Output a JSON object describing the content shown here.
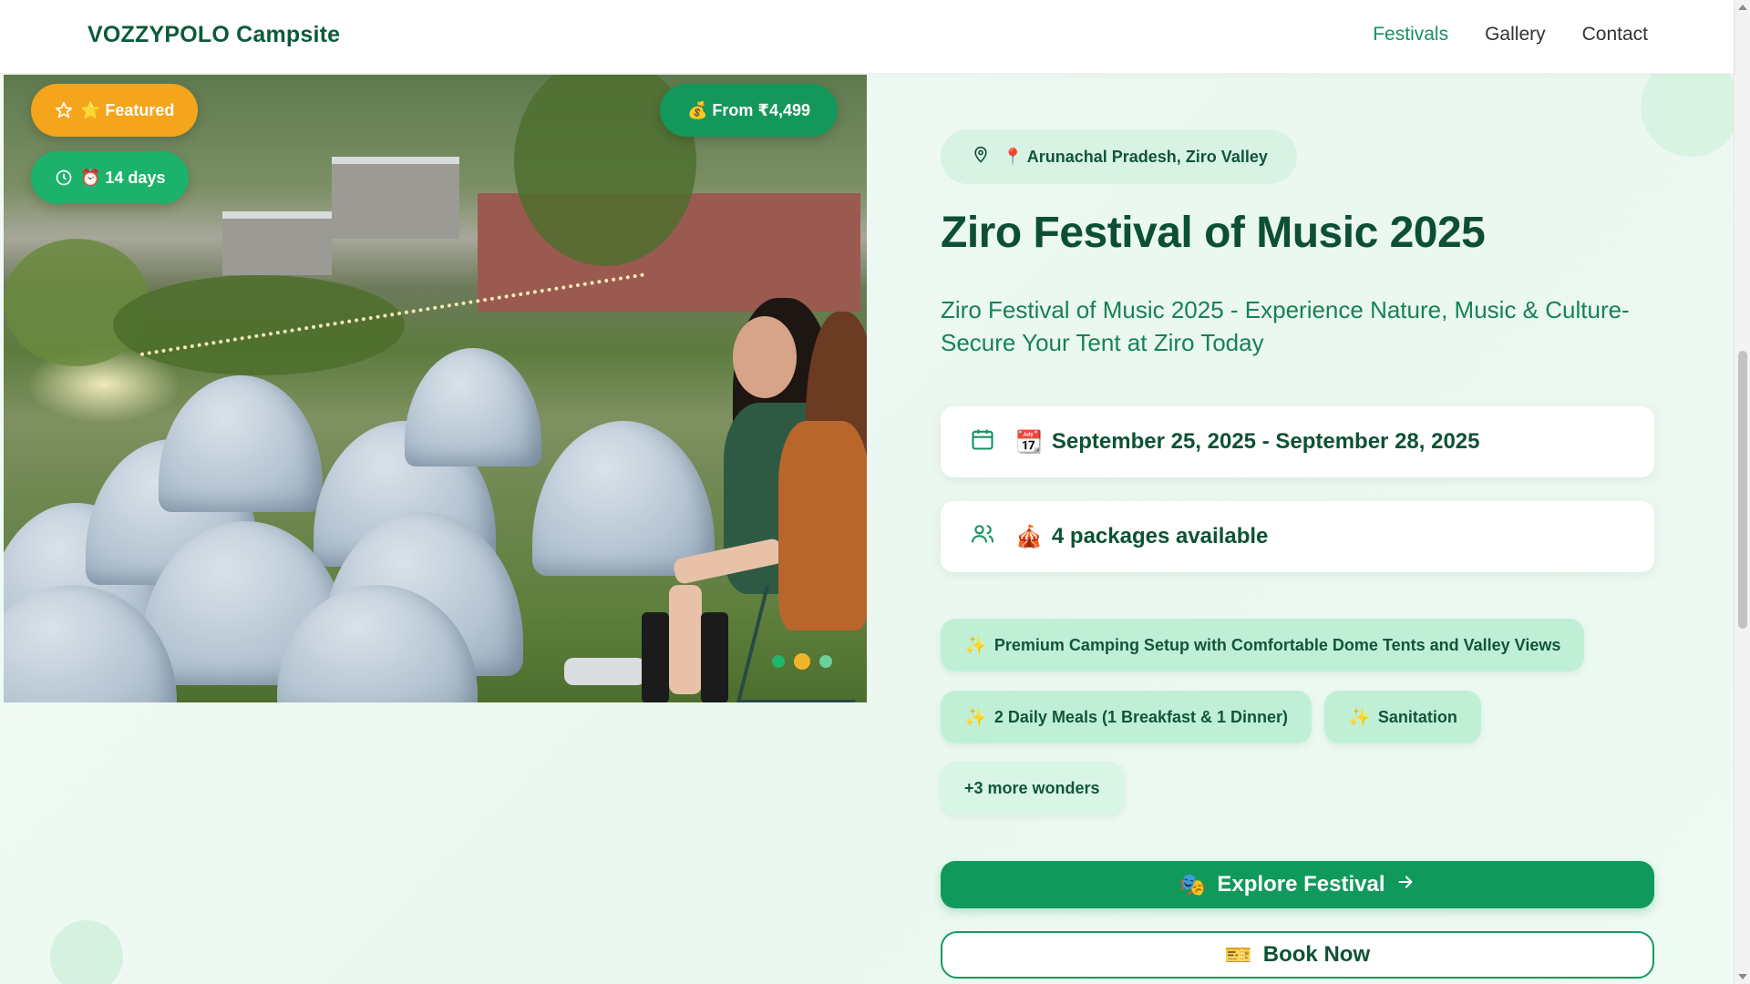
{
  "header": {
    "brand": "VOZZYPOLO Campsite",
    "nav": [
      {
        "label": "Festivals",
        "active": true
      },
      {
        "label": "Gallery",
        "active": false
      },
      {
        "label": "Contact",
        "active": false
      }
    ]
  },
  "hero": {
    "badges": {
      "featured": "⭐ Featured",
      "duration": "⏰ 14 days",
      "price": "💰 From ₹4,499"
    },
    "carousel": {
      "total_slides": 3,
      "active_slide": 2
    }
  },
  "event": {
    "location": "📍 Arunachal Pradesh, Ziro Valley",
    "title": "Ziro Festival of Music 2025",
    "description": "Ziro Festival of Music 2025 - Experience Nature, Music & Culture- Secure Your Tent at Ziro Today",
    "dates": "September 25, 2025 - September 28, 2025",
    "dates_emoji": "📆",
    "packages": "4 packages available",
    "packages_emoji": "🎪",
    "highlights": [
      "Premium Camping Setup with Comfortable Dome Tents and Valley Views",
      "2 Daily Meals (1 Breakfast & 1 Dinner)",
      "Sanitation"
    ],
    "highlight_icon": "✨",
    "more": "+3 more wonders"
  },
  "actions": {
    "explore_label": "Explore Festival",
    "explore_emoji": "🎭",
    "book_label": "Book Now",
    "book_emoji": "🎫"
  },
  "colors": {
    "primary": "#0f9a5b",
    "brand_text": "#0d5a3a",
    "featured_badge": "#f4a51c",
    "duration_badge": "#1db26c",
    "chip_bg": "#bff0d6"
  },
  "icons": [
    "star-icon",
    "clock-icon",
    "map-pin-icon",
    "calendar-icon",
    "users-icon",
    "arrow-right-icon"
  ]
}
